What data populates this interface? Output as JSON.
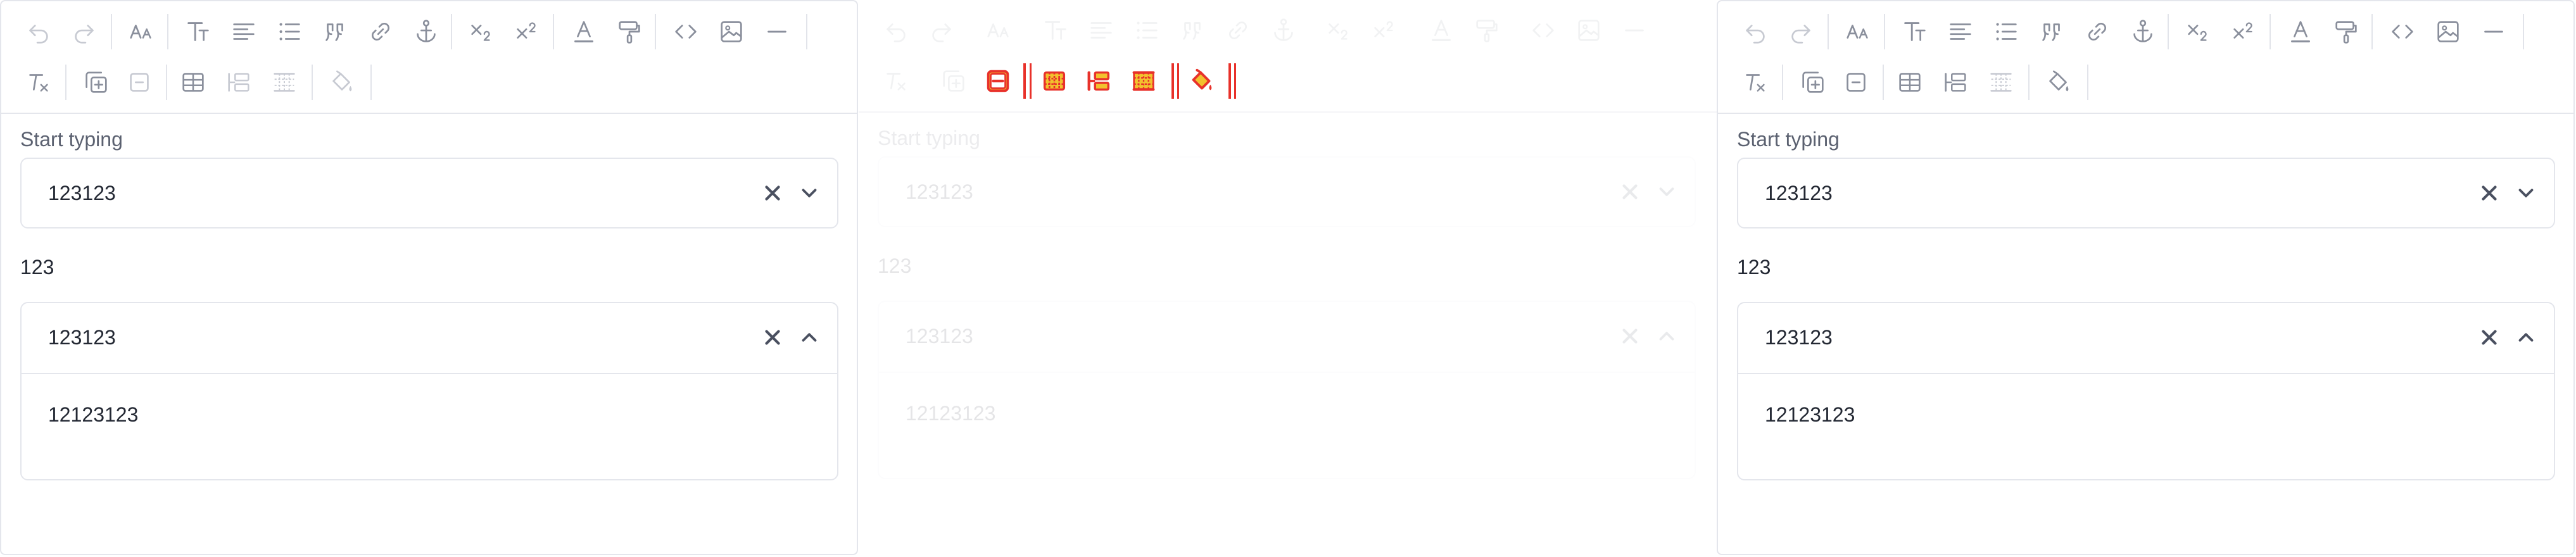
{
  "toolbar_icons": {
    "row1": [
      "undo-icon",
      "redo-icon",
      "font-size-icon",
      "text-style-icon",
      "align-icon",
      "bullet-list-icon",
      "blockquote-icon",
      "link-icon",
      "anchor-icon",
      "subscript-icon",
      "superscript-icon",
      "font-color-icon",
      "format-painter-icon",
      "code-icon",
      "image-icon",
      "horizontal-rule-icon"
    ],
    "row2": [
      "clear-formatting-icon",
      "add-block-icon",
      "remove-block-icon",
      "table-icon",
      "insert-row-icon",
      "table-grid-icon",
      "fill-color-icon"
    ],
    "ghost_row2": [
      "delete-row-icon",
      "delete-column-icon",
      "merge-cells-icon",
      "split-cells-icon",
      "clear-fill-icon"
    ]
  },
  "colors": {
    "icon": "#8a8f9c",
    "border": "#e4e6ec",
    "text": "#232833",
    "label": "#5b6170",
    "highlight": "#e8312a",
    "highlight_fill": "#f2c12e"
  },
  "panels": [
    {
      "start_label": "Start typing",
      "select_one": {
        "value": "123123"
      },
      "middle_text": "123",
      "select_two": {
        "value": "123123",
        "option": "12123123"
      }
    },
    {
      "start_label": "Start typing",
      "select_one": {
        "value": "123123"
      },
      "middle_text": "123",
      "select_two": {
        "value": "123123",
        "option": "12123123"
      }
    },
    {
      "start_label": "Start typing",
      "select_one": {
        "value": "123123"
      },
      "middle_text": "123",
      "select_two": {
        "value": "123123",
        "option": "12123123"
      }
    }
  ]
}
